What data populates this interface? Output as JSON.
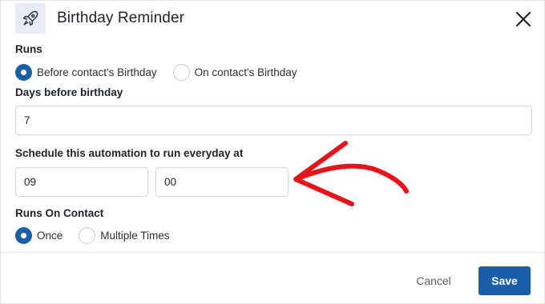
{
  "header": {
    "icon": "rocket-icon",
    "title": "Birthday Reminder",
    "close_icon": "close-icon"
  },
  "runs": {
    "label": "Runs",
    "options": [
      {
        "label": "Before contact's Birthday",
        "selected": true
      },
      {
        "label": "On contact's Birthday",
        "selected": false
      }
    ]
  },
  "days_before": {
    "label": "Days before birthday",
    "value": "7"
  },
  "schedule": {
    "label": "Schedule this automation to run everyday at",
    "hour": "09",
    "minute": "00"
  },
  "annotation": {
    "arrow_color": "#e4141b"
  },
  "runs_on_contact": {
    "label": "Runs On Contact",
    "options": [
      {
        "label": "Once",
        "selected": true
      },
      {
        "label": "Multiple Times",
        "selected": false
      }
    ]
  },
  "footer": {
    "cancel_label": "Cancel",
    "save_label": "Save"
  },
  "colors": {
    "primary": "#1b5ea8",
    "icon_bg": "#e8ecf6"
  }
}
